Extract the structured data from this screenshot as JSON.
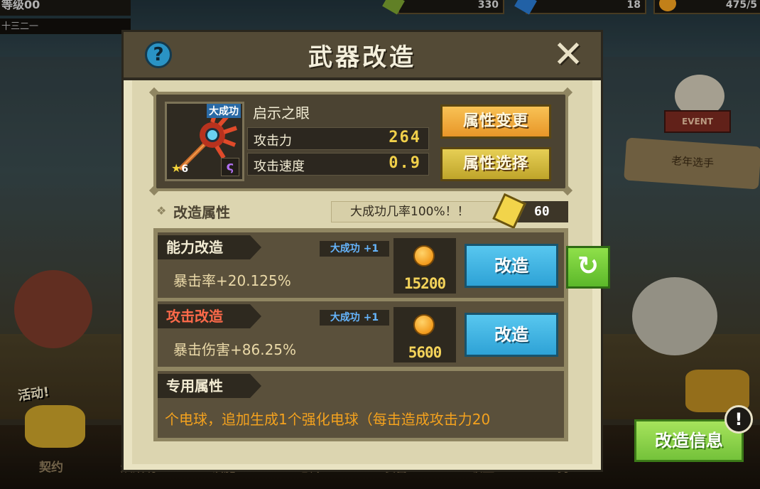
{
  "hud": {
    "level_text": "等级00",
    "sub_text": "十三二一",
    "resources": [
      {
        "icon": "green-gem-icon",
        "value": "330"
      },
      {
        "icon": "blue-gem-icon",
        "value": "18"
      },
      {
        "icon": "gold-coin-icon",
        "value": "475/5"
      }
    ]
  },
  "background": {
    "event_banner": "EVENT",
    "ribbon_text": "老年选手",
    "activity_label": "活动!",
    "bottom_nav": [
      "契约",
      "烘焙坊",
      "设施",
      "仓库",
      "装备",
      "领主",
      "勇士"
    ]
  },
  "modal": {
    "title": "武器改造",
    "help_symbol": "?",
    "close_symbol": "✕",
    "weapon": {
      "icon": "staff-weapon-icon",
      "great_success_tag": "大成功",
      "star_level": "6",
      "name": "启示之眼",
      "stats": [
        {
          "label": "攻击力",
          "value": "264"
        },
        {
          "label": "攻击速度",
          "value": "0.9"
        }
      ]
    },
    "buttons": {
      "attribute_change": "属性变更",
      "attribute_select": "属性选择"
    },
    "section": {
      "title": "改造属性",
      "rate_text": "大成功几率100%！！",
      "ticket_cost": "60"
    },
    "reforms": [
      {
        "title": "能力改造",
        "great_badge": "大成功 +1",
        "effect": "暴击率+20.125%",
        "cost": "15200",
        "button": "改造"
      },
      {
        "title": "攻击改造",
        "great_badge": "大成功 +1",
        "effect": "暴击伤害+86.25%",
        "cost": "5600",
        "button": "改造"
      }
    ],
    "special": {
      "title": "专用属性",
      "text": "个电球，追加生成1个强化电球（每击造成攻击力20"
    }
  },
  "side": {
    "refresh_symbol": "↻",
    "reform_info": "改造信息",
    "alert_symbol": "!"
  },
  "colors": {
    "modal_header": "#534a36",
    "panel_bg": "#e9e3c2",
    "gold_button": "#f8c255",
    "blue_button": "#3fb4e4",
    "green_button": "#8fd64a",
    "value_yellow": "#f1d04a",
    "special_orange": "#f4a21e",
    "red_title": "#ff6a4a"
  }
}
